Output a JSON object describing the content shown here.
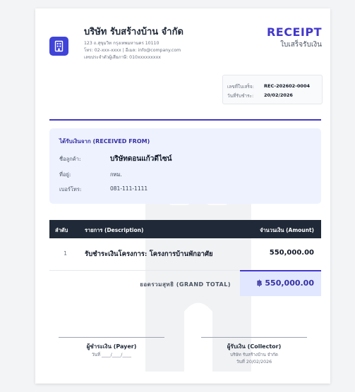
{
  "company": {
    "name": "บริษัท รับสร้างบ้าน จำกัด",
    "address": "123 ถ.สุขุมวิท กรุงเทพมหานคร 10110",
    "contact": "โทร: 02-xxx-xxxx | อีเมล: info@company.com",
    "tax_id": "เลขประจำตัวผู้เสียภาษี: 010xxxxxxxxx"
  },
  "receipt": {
    "title": "RECEIPT",
    "subtitle": "ใบเสร็จรับเงิน",
    "number_label": "เลขที่ใบเสร็จ:",
    "number": "REC-202602-0004",
    "date_label": "วันที่รับชำระ:",
    "date": "20/02/2026"
  },
  "received_from": {
    "title": "ได้รับเงินจาก (RECEIVED FROM)",
    "customer_label": "ชื่อลูกค้า:",
    "customer": "บริษัทดอนแก้วดีไซน์",
    "address_label": "ที่อยู่:",
    "address": "กทม.",
    "phone_label": "เบอร์โทร:",
    "phone": "081-111-1111"
  },
  "table": {
    "headers": {
      "no": "ลำดับ",
      "description": "รายการ (Description)",
      "amount": "จำนวนเงิน (Amount)"
    },
    "rows": [
      {
        "no": "1",
        "description": "รับชำระเงินโครงการ: โครงการบ้านพักอาศัย",
        "amount": "550,000.00"
      }
    ],
    "grand_total_label": "ยอดรวมสุทธิ (GRAND TOTAL)",
    "grand_total": "฿ 550,000.00"
  },
  "signatures": {
    "payer": {
      "title": "ผู้ชำระเงิน (Payer)",
      "date_line": "วันที่ ____/____/____"
    },
    "collector": {
      "title": "ผู้รับเงิน (Collector)",
      "company": "บริษัท รับสร้างบ้าน จำกัด",
      "date_line": "วันที่ 20/02/2026"
    }
  },
  "colors": {
    "accent": "#4338ca",
    "header_dark": "#1f2937",
    "panel": "#eef2ff"
  },
  "icons": {
    "logo": "building-icon"
  }
}
